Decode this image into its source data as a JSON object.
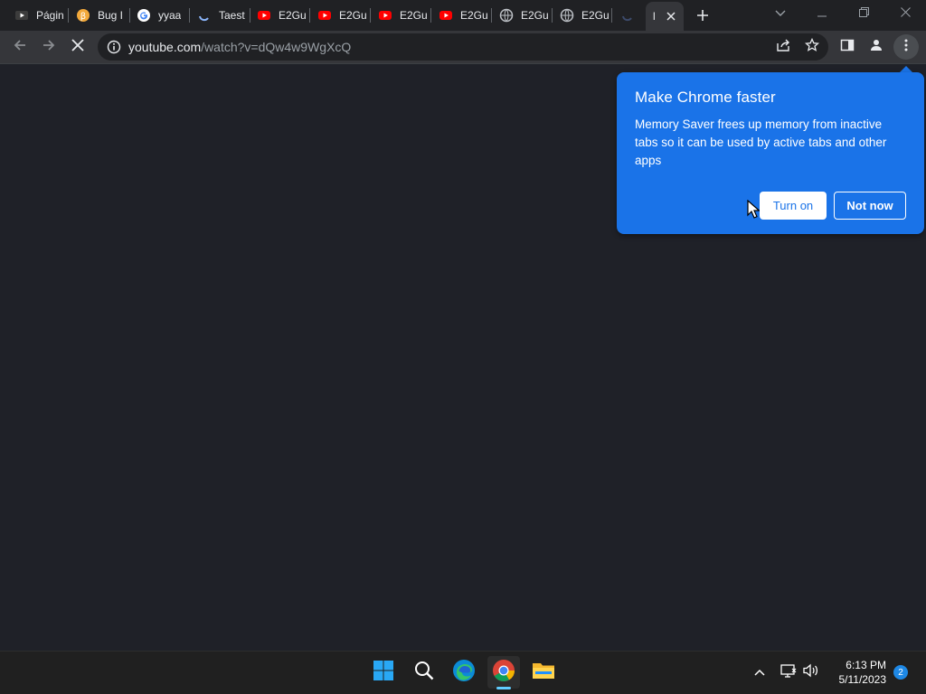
{
  "tabs": [
    {
      "title": "Págin",
      "icon": "youtube-dark-icon"
    },
    {
      "title": "Bug I",
      "icon": "bug-bounty-icon"
    },
    {
      "title": "yyaa",
      "icon": "google-icon"
    },
    {
      "title": "Taest",
      "icon": "loading-spinner-icon"
    },
    {
      "title": "E2Gu",
      "icon": "youtube-icon"
    },
    {
      "title": "E2Gu",
      "icon": "youtube-icon"
    },
    {
      "title": "E2Gu",
      "icon": "youtube-icon"
    },
    {
      "title": "E2Gu",
      "icon": "youtube-icon"
    },
    {
      "title": "E2Gu",
      "icon": "globe-icon"
    },
    {
      "title": "E2Gu",
      "icon": "globe-icon"
    },
    {
      "title": "",
      "icon": "loading-spinner-icon"
    },
    {
      "title": "l",
      "icon": "none",
      "active": true
    }
  ],
  "omnibox": {
    "url_host": "youtube.com",
    "url_path": "/watch?v=dQw4w9WgXcQ"
  },
  "bubble": {
    "title": "Make Chrome faster",
    "body": "Memory Saver frees up memory from inactive tabs so it can be used by active tabs and other apps",
    "primary_label": "Turn on",
    "secondary_label": "Not now"
  },
  "taskbar": {
    "time": "6:13 PM",
    "date": "5/11/2023",
    "notification_count": "2"
  },
  "colors": {
    "bubble_bg": "#1a73e8",
    "page_bg": "#1f2128",
    "youtube_red": "#ff0000"
  }
}
